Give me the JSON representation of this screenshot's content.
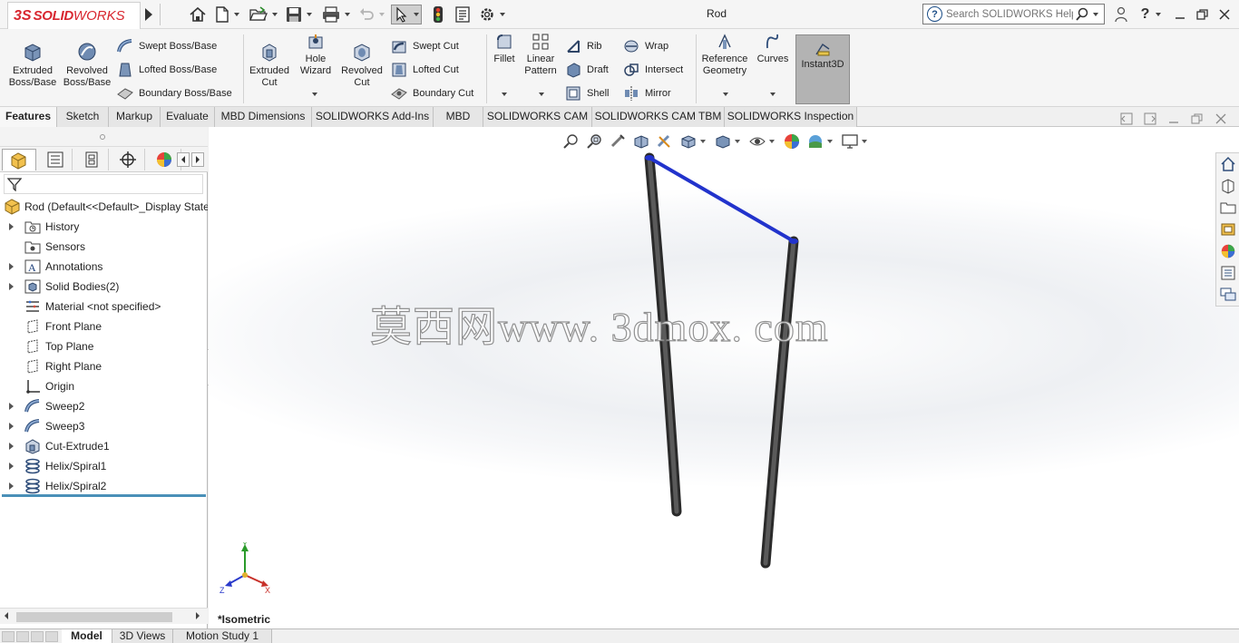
{
  "app": {
    "title": "Rod",
    "logo_ds": "3S",
    "logo_brand": "SOLID",
    "logo_brand2": "WORKS"
  },
  "search": {
    "placeholder": "Search SOLIDWORKS Help"
  },
  "command_manager": {
    "extruded_boss": "Extruded\nBoss/Base",
    "revolved_boss": "Revolved\nBoss/Base",
    "swept_boss": "Swept Boss/Base",
    "lofted_boss": "Lofted Boss/Base",
    "boundary_boss": "Boundary Boss/Base",
    "extruded_cut": "Extruded\nCut",
    "hole_wizard": "Hole\nWizard",
    "revolved_cut": "Revolved\nCut",
    "swept_cut": "Swept Cut",
    "lofted_cut": "Lofted Cut",
    "boundary_cut": "Boundary Cut",
    "fillet": "Fillet",
    "linear_pattern": "Linear\nPattern",
    "rib": "Rib",
    "draft": "Draft",
    "shell": "Shell",
    "wrap": "Wrap",
    "intersect": "Intersect",
    "mirror": "Mirror",
    "reference_geometry": "Reference\nGeometry",
    "curves": "Curves",
    "instant3d": "Instant3D"
  },
  "tabs": [
    "Features",
    "Sketch",
    "Markup",
    "Evaluate",
    "MBD Dimensions",
    "SOLIDWORKS Add-Ins",
    "MBD",
    "SOLIDWORKS CAM",
    "SOLIDWORKS CAM TBM",
    "SOLIDWORKS Inspection"
  ],
  "tree": {
    "root": "Rod  (Default<<Default>_Display State",
    "items": [
      {
        "label": "History"
      },
      {
        "label": "Sensors"
      },
      {
        "label": "Annotations"
      },
      {
        "label": "Solid Bodies(2)"
      },
      {
        "label": "Material <not specified>"
      },
      {
        "label": "Front Plane"
      },
      {
        "label": "Top Plane"
      },
      {
        "label": "Right Plane"
      },
      {
        "label": "Origin"
      },
      {
        "label": "Sweep2"
      },
      {
        "label": "Sweep3"
      },
      {
        "label": "Cut-Extrude1"
      },
      {
        "label": "Helix/Spiral1"
      },
      {
        "label": "Helix/Spiral2"
      }
    ]
  },
  "viewport": {
    "watermark": "莫西网www. 3dmox. com",
    "view_name": "*Isometric",
    "triad": {
      "y": "Y",
      "x": "X",
      "z": "Z"
    }
  },
  "bottom_tabs": [
    "Model",
    "3D Views",
    "Motion Study 1"
  ],
  "colors": {
    "accent": "#d8262f",
    "edge_highlight": "#2233cc",
    "rod": "#3a3a3a"
  }
}
